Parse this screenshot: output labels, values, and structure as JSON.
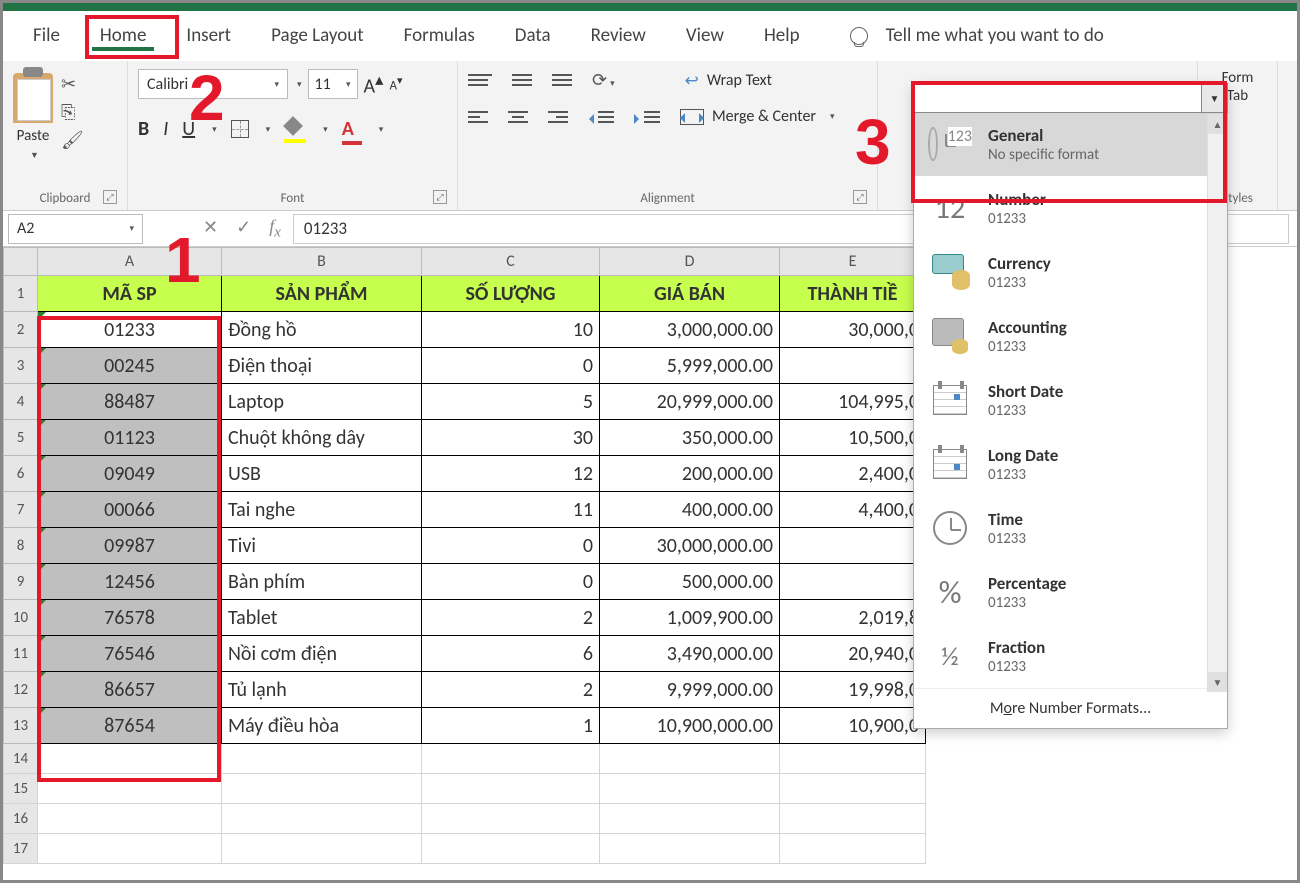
{
  "tabs": {
    "file": "File",
    "home": "Home",
    "insert": "Insert",
    "page_layout": "Page Layout",
    "formulas": "Formulas",
    "data": "Data",
    "review": "Review",
    "view": "View",
    "help": "Help"
  },
  "tell_me": "Tell me what you want to do",
  "ribbon": {
    "clipboard": {
      "paste": "Paste",
      "label": "Clipboard"
    },
    "font": {
      "name": "Calibri",
      "size": "11",
      "label": "Font",
      "bold": "B",
      "italic": "I",
      "underline": "U",
      "color_letter": "A"
    },
    "alignment": {
      "wrap": "Wrap Text",
      "merge": "Merge & Center",
      "label": "Alignment"
    },
    "styles": {
      "format_table": "Form\nTab",
      "label": "Styles"
    }
  },
  "namebox": "A2",
  "formula": "01233",
  "columns": [
    "A",
    "B",
    "C",
    "D",
    "E"
  ],
  "headers": {
    "a": "MÃ SP",
    "b": "SẢN PHẨM",
    "c": "SỐ LƯỢNG",
    "d": "GIÁ BÁN",
    "e": "THÀNH TIỀ"
  },
  "rows": [
    {
      "n": "2",
      "a": "01233",
      "b": "Đồng hồ",
      "c": "10",
      "d": "3,000,000.00",
      "e": "30,000,0",
      "active": true
    },
    {
      "n": "3",
      "a": "00245",
      "b": "Điện thoại",
      "c": "0",
      "d": "5,999,000.00",
      "e": ""
    },
    {
      "n": "4",
      "a": "88487",
      "b": "Laptop",
      "c": "5",
      "d": "20,999,000.00",
      "e": "104,995,0"
    },
    {
      "n": "5",
      "a": "01123",
      "b": "Chuột không dây",
      "c": "30",
      "d": "350,000.00",
      "e": "10,500,0"
    },
    {
      "n": "6",
      "a": "09049",
      "b": "USB",
      "c": "12",
      "d": "200,000.00",
      "e": "2,400,0"
    },
    {
      "n": "7",
      "a": "00066",
      "b": "Tai nghe",
      "c": "11",
      "d": "400,000.00",
      "e": "4,400,0"
    },
    {
      "n": "8",
      "a": "09987",
      "b": "Tivi",
      "c": "0",
      "d": "30,000,000.00",
      "e": ""
    },
    {
      "n": "9",
      "a": "12456",
      "b": "Bàn phím",
      "c": "0",
      "d": "500,000.00",
      "e": ""
    },
    {
      "n": "10",
      "a": "76578",
      "b": "Tablet",
      "c": "2",
      "d": "1,009,900.00",
      "e": "2,019,8"
    },
    {
      "n": "11",
      "a": "76546",
      "b": "Nồi cơm điện",
      "c": "6",
      "d": "3,490,000.00",
      "e": "20,940,0"
    },
    {
      "n": "12",
      "a": "86657",
      "b": "Tủ lạnh",
      "c": "2",
      "d": "9,999,000.00",
      "e": "19,998,0"
    },
    {
      "n": "13",
      "a": "87654",
      "b": "Máy điều hòa",
      "c": "1",
      "d": "10,900,000.00",
      "e": "10,900,0"
    }
  ],
  "empty_rows": [
    "14",
    "15",
    "16",
    "17"
  ],
  "dropdown": {
    "items": [
      {
        "key": "general",
        "title": "General",
        "sub": "No specific format",
        "ico": "gen"
      },
      {
        "key": "number",
        "title": "Number",
        "sub": "01233",
        "ico": "12"
      },
      {
        "key": "currency",
        "title": "Currency",
        "sub": "01233",
        "ico": "cur"
      },
      {
        "key": "accounting",
        "title": "Accounting",
        "sub": " 01233",
        "ico": "acct"
      },
      {
        "key": "shortdate",
        "title": "Short Date",
        "sub": "01233",
        "ico": "cal1"
      },
      {
        "key": "longdate",
        "title": "Long Date",
        "sub": "01233",
        "ico": "cal2"
      },
      {
        "key": "time",
        "title": "Time",
        "sub": "01233",
        "ico": "clock"
      },
      {
        "key": "percentage",
        "title": "Percentage",
        "sub": "01233",
        "ico": "pct"
      },
      {
        "key": "fraction",
        "title": "Fraction",
        "sub": "01233",
        "ico": "frac"
      }
    ],
    "more_pre": "M",
    "more_u": "o",
    "more_post": "re Number Formats..."
  },
  "annotations": {
    "n1": "1",
    "n2": "2",
    "n3": "3"
  }
}
